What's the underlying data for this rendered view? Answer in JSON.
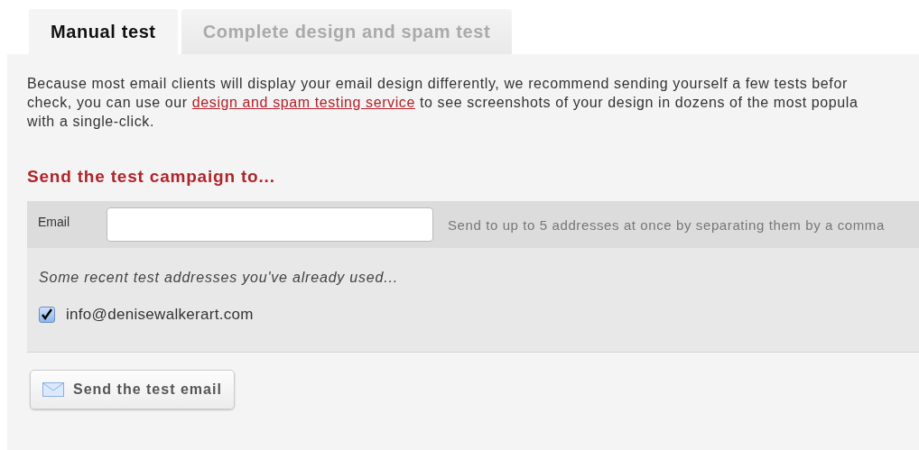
{
  "tabs": [
    {
      "label": "Manual test",
      "selected": true
    },
    {
      "label": "Complete design and spam test",
      "selected": false
    }
  ],
  "intro": {
    "line_1": "Because most email clients will display your email design differently, we recommend sending yourself a few tests befor",
    "line_2_before_link": "check, you can use our",
    "link": "design and spam testing service",
    "line_2_after_link": "to see screenshots of your design in dozens of the most popula",
    "line_3": "with a single-click."
  },
  "heading": "Send the test campaign to...",
  "email": {
    "label": "Email",
    "hint": "Send to up to 5 addresses at once by separating them by a comma"
  },
  "recent": {
    "title": "Some recent test addresses you've already used...",
    "addresses": [
      {
        "address": "info@denisewalkerart.com",
        "checked": true
      }
    ]
  },
  "send_button": "Send the test email"
}
